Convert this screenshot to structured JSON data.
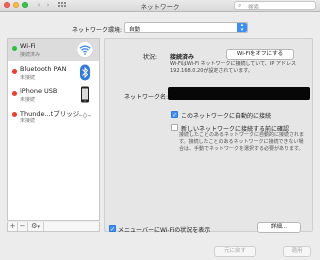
{
  "window": {
    "title": "ネットワーク"
  },
  "search": {
    "placeholder": "検索"
  },
  "location": {
    "label": "ネットワーク環境:",
    "value": "自動"
  },
  "services": [
    {
      "name": "Wi-Fi",
      "status": "接続済み",
      "state": "connected",
      "icon": "wifi-icon"
    },
    {
      "name": "Bluetooth PAN",
      "status": "未接続",
      "state": "disconnected",
      "icon": "bluetooth-icon"
    },
    {
      "name": "iPhone USB",
      "status": "未接続",
      "state": "disconnected",
      "icon": "phone-icon"
    },
    {
      "name": "Thunde...tブリッジ",
      "status": "未接続",
      "state": "disconnected",
      "icon": "thunderbolt-icon"
    }
  ],
  "sidebar_tools": {
    "add": "+",
    "remove": "−",
    "gear": "⚙"
  },
  "detail": {
    "status_label": "状況:",
    "status_value": "接続済み",
    "wifi_off_button": "Wi-Fiをオフにする",
    "status_description": "Wi-FiはWi-Fi ネットワークに接続していて、IP アドレス 192.168.0.20が設定されています。",
    "network_name_label": "ネットワーク名:",
    "auto_join_label": "このネットワークに自動的に接続",
    "auto_join_checked": true,
    "ask_join_label": "新しいネットワークに接続する前に確認",
    "ask_join_checked": false,
    "ask_join_description": "接続したことのあるネットワークに自動的に接続されます。接続したことのあるネットワークに接続できない場合は、手動でネットワークを選択する必要があります。",
    "menubar_label": "メニューバーにWi-Fiの状況を表示",
    "menubar_checked": true,
    "advanced_button": "詳細..."
  },
  "footer": {
    "revert_button": "元に戻す",
    "apply_button": "適用"
  },
  "colors": {
    "accent": "#3e8ef7",
    "connected": "#27c43a",
    "disconnected": "#f33b2f"
  }
}
